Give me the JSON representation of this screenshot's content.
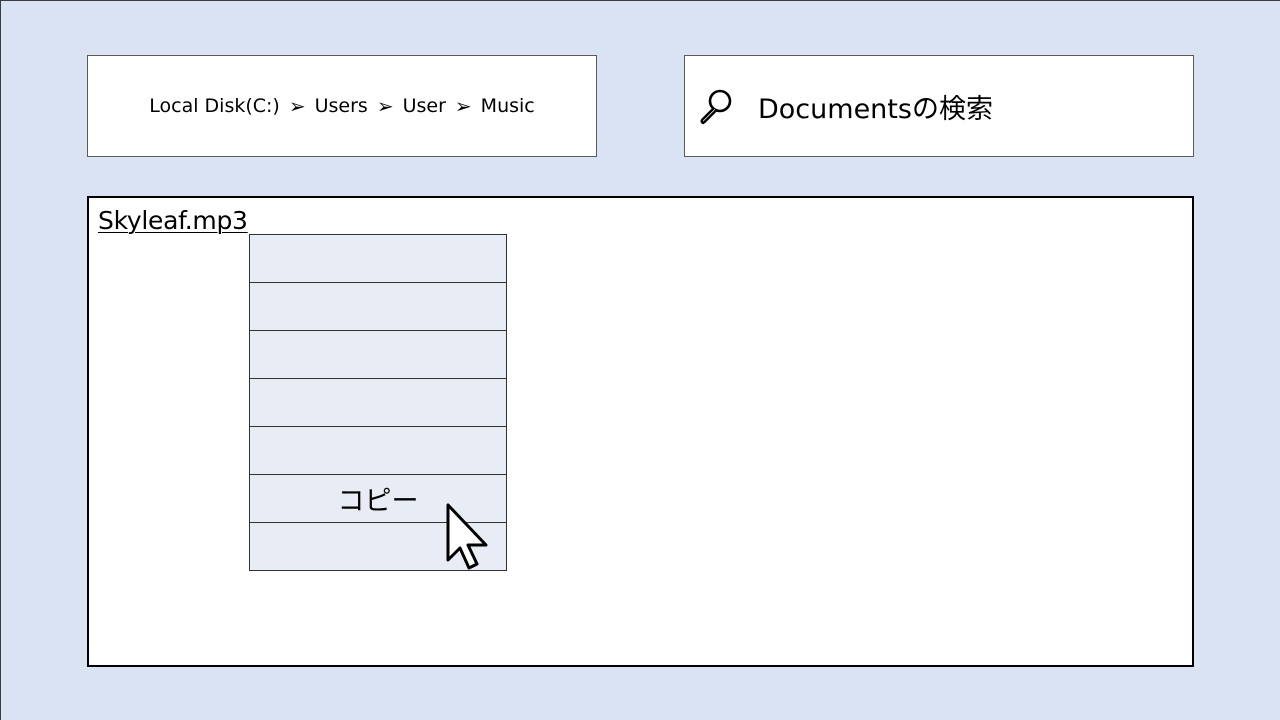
{
  "breadcrumb": {
    "items": [
      "Local Disk(C:)",
      "Users",
      "User",
      "Music"
    ],
    "separator": "➢"
  },
  "search": {
    "placeholder": "Documentsの検索"
  },
  "file": {
    "name": "Skyleaf.mp3"
  },
  "context_menu": {
    "items": [
      {
        "label": ""
      },
      {
        "label": ""
      },
      {
        "label": ""
      },
      {
        "label": ""
      },
      {
        "label": ""
      },
      {
        "label": "コピー"
      },
      {
        "label": ""
      }
    ]
  },
  "colors": {
    "background": "#dae3f3",
    "menu_background": "#e8ecf5"
  },
  "icons": {
    "search": "magnifier-icon",
    "cursor": "mouse-pointer-icon"
  }
}
